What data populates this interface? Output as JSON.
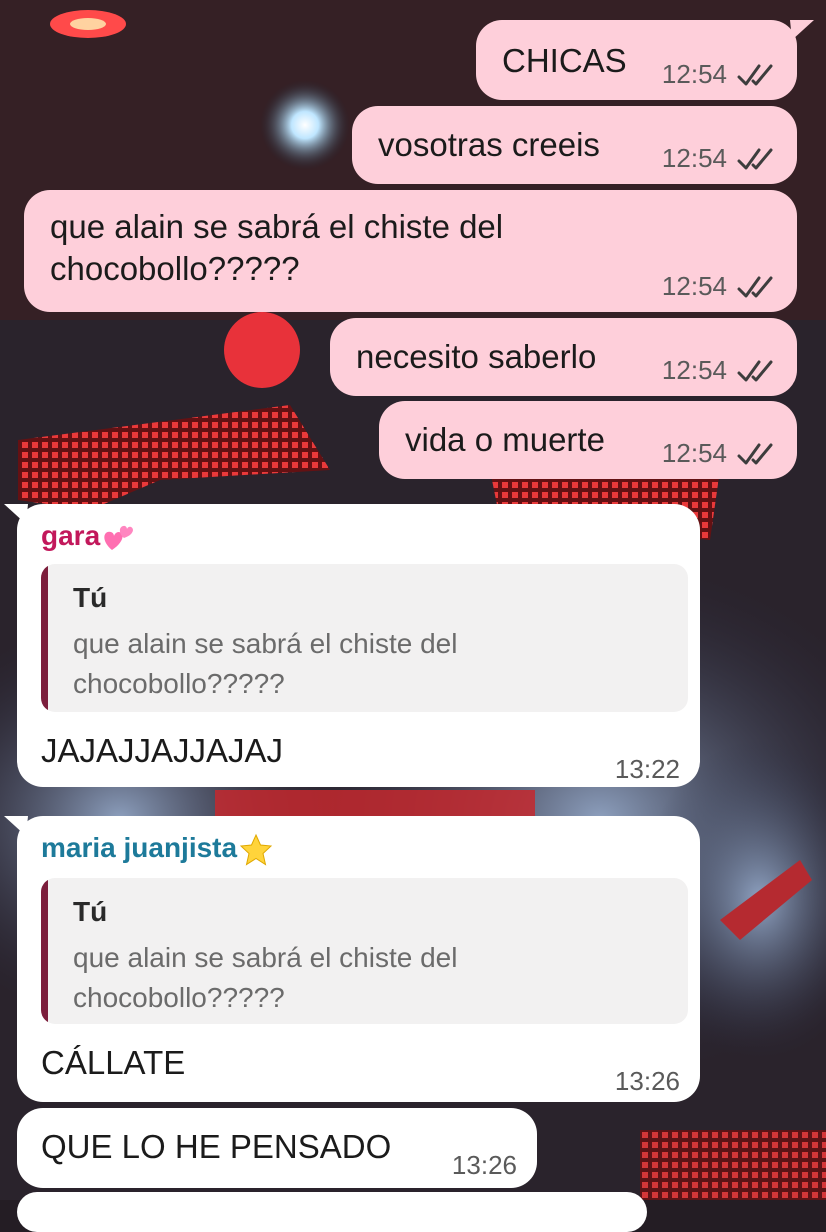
{
  "outgoing": [
    {
      "text": "CHICAS",
      "time": "12:54"
    },
    {
      "text": "vosotras creeis",
      "time": "12:54"
    },
    {
      "text": "que alain se sabrá el chiste del",
      "text2": "chocobollo?????",
      "time": "12:54"
    },
    {
      "text": "necesito saberlo",
      "time": "12:54"
    },
    {
      "text": "vida o muerte",
      "time": "12:54"
    }
  ],
  "incoming": [
    {
      "sender": "gara",
      "sender_emoji": "two-hearts-icon",
      "sender_color": "#c2185b",
      "quote_name": "Tú",
      "quote_text": "que alain se sabrá el chiste del chocobollo?????",
      "text": "JAJAJJAJJAJAJ",
      "time": "13:22"
    },
    {
      "sender": "maria juanjista",
      "sender_emoji": "star-icon",
      "sender_color": "#1d7a9a",
      "quote_name": "Tú",
      "quote_text": "que alain se sabrá el chiste del chocobollo?????",
      "text": "CÁLLATE",
      "time": "13:26"
    },
    {
      "text": "QUE LO HE PENSADO",
      "time": "13:26"
    }
  ],
  "colors": {
    "outgoing_bubble": "#fecfda",
    "incoming_bubble": "#ffffff",
    "quote_bar": "#7c1e3c",
    "read_ticks": "#3d3d3d"
  }
}
